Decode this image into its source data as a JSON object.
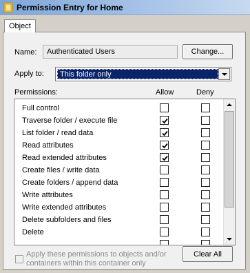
{
  "window": {
    "title": "Permission Entry for Home"
  },
  "tabs": [
    {
      "label": "Object"
    }
  ],
  "name_row": {
    "label": "Name:",
    "value": "Authenticated Users",
    "change_button": "Change..."
  },
  "apply_to": {
    "label": "Apply to:",
    "selected": "This folder only"
  },
  "permissions": {
    "header": "Permissions:",
    "allow_header": "Allow",
    "deny_header": "Deny",
    "rows": [
      {
        "label": "Full control",
        "allow": false,
        "deny": false
      },
      {
        "label": "Traverse folder / execute file",
        "allow": true,
        "deny": false
      },
      {
        "label": "List folder / read data",
        "allow": true,
        "deny": false
      },
      {
        "label": "Read attributes",
        "allow": true,
        "deny": false
      },
      {
        "label": "Read extended attributes",
        "allow": true,
        "deny": false
      },
      {
        "label": "Create files / write data",
        "allow": false,
        "deny": false
      },
      {
        "label": "Create folders / append data",
        "allow": false,
        "deny": false
      },
      {
        "label": "Write attributes",
        "allow": false,
        "deny": false
      },
      {
        "label": "Write extended attributes",
        "allow": false,
        "deny": false
      },
      {
        "label": "Delete subfolders and files",
        "allow": false,
        "deny": false
      },
      {
        "label": "Delete",
        "allow": false,
        "deny": false
      },
      {
        "label": "",
        "allow": false,
        "deny": false
      }
    ]
  },
  "apply_children": {
    "checked": false,
    "text": "Apply these permissions to objects and/or containers within this container only"
  },
  "clear_all_button": "Clear All",
  "colors": {
    "selection": "#0a246a",
    "titlebar": "#a8c4e8",
    "panel": "#f0f0f0"
  }
}
